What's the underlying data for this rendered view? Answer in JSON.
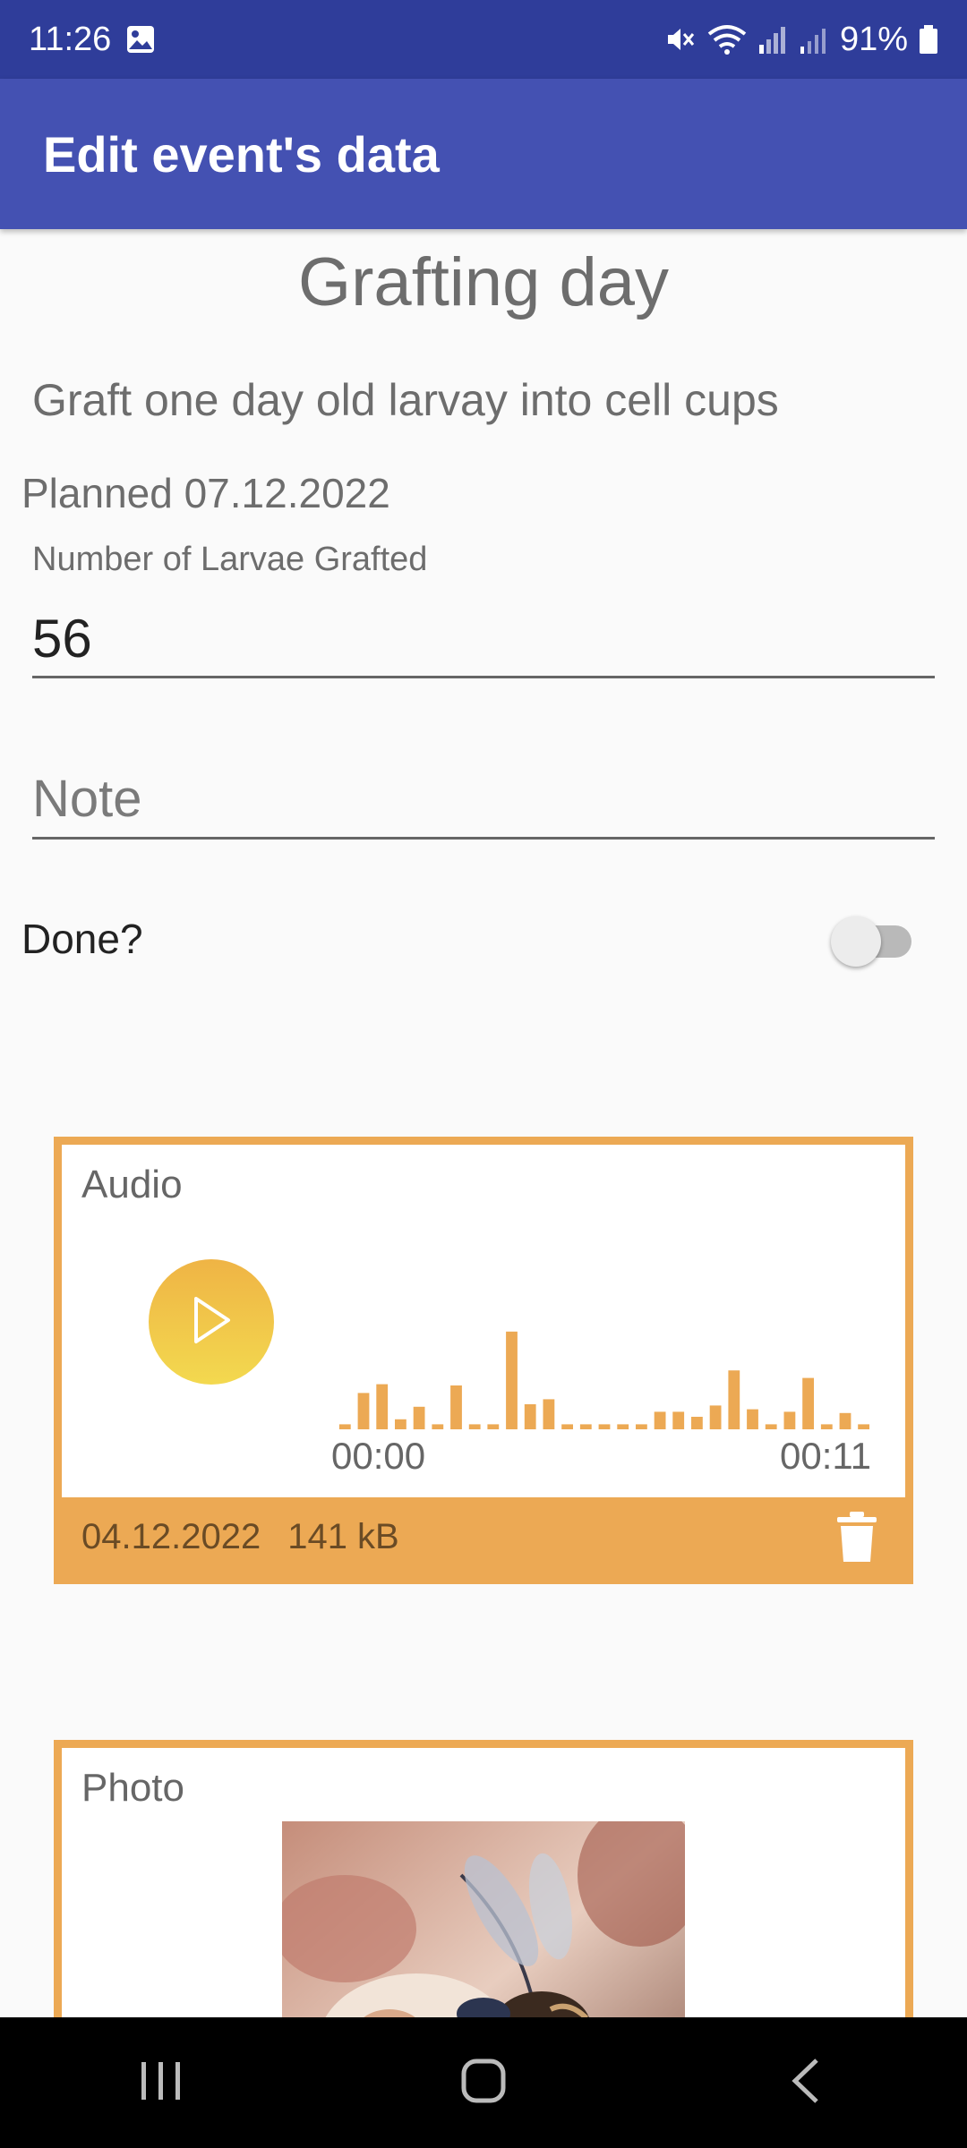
{
  "status_bar": {
    "time": "11:26",
    "battery": "91%",
    "icons": [
      "image-icon",
      "mute-icon",
      "wifi-icon",
      "signal-icon",
      "signal-weak-icon",
      "battery-icon"
    ]
  },
  "app_bar": {
    "title": "Edit event's data"
  },
  "event": {
    "title": "Grafting day",
    "description": "Graft one day old larvay into cell cups",
    "planned": "Planned 07.12.2022"
  },
  "larvae_field": {
    "label": "Number of Larvae Grafted",
    "value": "56"
  },
  "note_field": {
    "placeholder": "Note",
    "value": ""
  },
  "done": {
    "label": "Done?",
    "checked": false
  },
  "audio": {
    "label": "Audio",
    "time_start": "00:00",
    "time_end": "00:11",
    "date": "04.12.2022",
    "size": "141 kB",
    "waveform_levels": [
      0.04,
      0.29,
      0.36,
      0.08,
      0.18,
      0.04,
      0.35,
      0.04,
      0.04,
      0.78,
      0.2,
      0.24,
      0.04,
      0.04,
      0.04,
      0.04,
      0.04,
      0.14,
      0.14,
      0.1,
      0.19,
      0.47,
      0.16,
      0.04,
      0.14,
      0.41,
      0.04,
      0.13,
      0.04
    ],
    "accent_color": "#eca954"
  },
  "photo": {
    "label": "Photo"
  },
  "colors": {
    "status_bar": "#2f3d9a",
    "app_bar": "#4451b2",
    "card_border": "#eca954",
    "play_gradient": [
      "#efb445",
      "#f3d94f"
    ]
  },
  "nav_bar": {
    "icons": [
      "recent-apps-icon",
      "home-icon",
      "back-icon"
    ]
  }
}
